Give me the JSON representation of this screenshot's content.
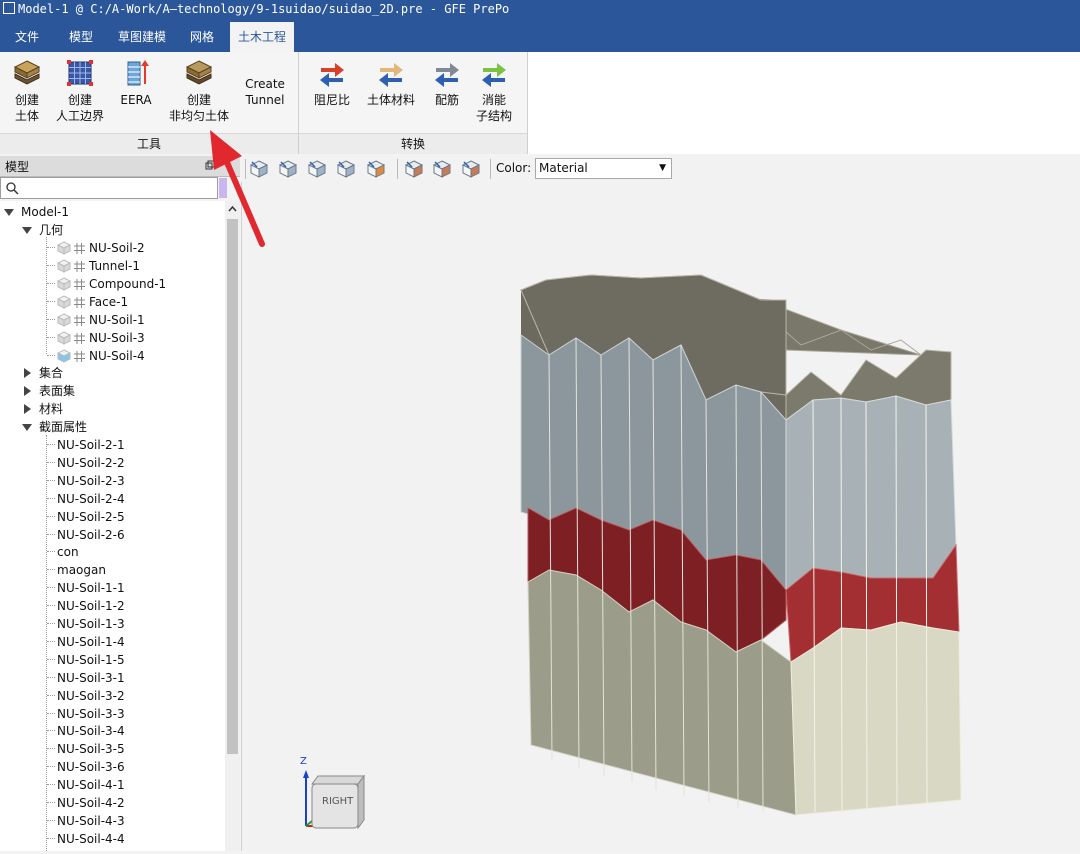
{
  "window": {
    "title": "Model-1 @ C:/A-Work/A—technology/9-1suidao/suidao_2D.pre - GFE PrePo"
  },
  "menu": [
    {
      "label": "文件"
    },
    {
      "label": "模型"
    },
    {
      "label": "草图建模"
    },
    {
      "label": "网格"
    },
    {
      "label": "土木工程"
    }
  ],
  "ribbon": {
    "tools_group": {
      "label": "工具",
      "buttons": [
        {
          "line1": "创建",
          "line2": "土体"
        },
        {
          "line1": "创建",
          "line2": "人工边界"
        },
        {
          "line1": "EERA",
          "line2": ""
        },
        {
          "line1": "创建",
          "line2": "非均匀土体"
        },
        {
          "line1": "Create",
          "line2": "Tunnel"
        }
      ]
    },
    "convert_group": {
      "label": "转换",
      "buttons": [
        {
          "line1": "阻尼比",
          "line2": ""
        },
        {
          "line1": "土体材料",
          "line2": ""
        },
        {
          "line1": "配筋",
          "line2": ""
        },
        {
          "line1": "消能",
          "line2": "子结构"
        }
      ]
    }
  },
  "panel": {
    "title": "模型",
    "search_placeholder": ""
  },
  "tree": {
    "root": "Model-1",
    "geometry": {
      "label": "几何",
      "items": [
        "NU-Soil-2",
        "Tunnel-1",
        "Compound-1",
        "Face-1",
        "NU-Soil-1",
        "NU-Soil-3",
        "NU-Soil-4"
      ]
    },
    "sets": "集合",
    "surface_sets": "表面集",
    "materials": "材料",
    "sections": {
      "label": "截面属性",
      "items": [
        "NU-Soil-2-1",
        "NU-Soil-2-2",
        "NU-Soil-2-3",
        "NU-Soil-2-4",
        "NU-Soil-2-5",
        "NU-Soil-2-6",
        "con",
        "maogan",
        "NU-Soil-1-1",
        "NU-Soil-1-2",
        "NU-Soil-1-3",
        "NU-Soil-1-4",
        "NU-Soil-1-5",
        "NU-Soil-3-1",
        "NU-Soil-3-2",
        "NU-Soil-3-3",
        "NU-Soil-3-4",
        "NU-Soil-3-5",
        "NU-Soil-3-6",
        "NU-Soil-4-1",
        "NU-Soil-4-2",
        "NU-Soil-4-3",
        "NU-Soil-4-4"
      ]
    }
  },
  "viewport_toolbar": {
    "color_label": "Color:",
    "color_value": "Material"
  },
  "view_cube": {
    "face": "RIGHT",
    "axis_z": "Z"
  },
  "colors": {
    "title_bar": "#2b579a",
    "layer_top": "#6c6a5e",
    "layer_grey": "#8c979d",
    "layer_red": "#8a2428",
    "layer_bottom": "#9b9c8a",
    "annotation_arrow": "#e0282e"
  }
}
